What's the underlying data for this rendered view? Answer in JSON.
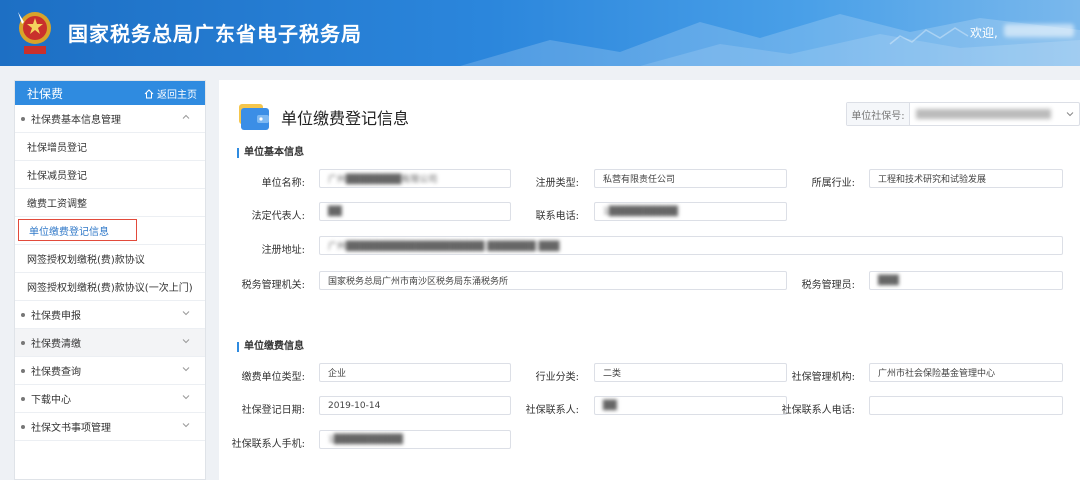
{
  "header": {
    "title": "国家税务总局广东省电子税务局",
    "welcome": "欢迎,"
  },
  "sidebar": {
    "section_title": "社保费",
    "home_label": "返回主页",
    "items": [
      {
        "label": "社保费基本信息管理"
      },
      {
        "label": "社保增员登记"
      },
      {
        "label": "社保减员登记"
      },
      {
        "label": "缴费工资调整"
      },
      {
        "label": "单位缴费登记信息"
      },
      {
        "label": "网签授权划缴税(费)款协议"
      },
      {
        "label": "网签授权划缴税(费)款协议(一次上门)"
      },
      {
        "label": "社保费申报"
      },
      {
        "label": "社保费清缴"
      },
      {
        "label": "社保费查询"
      },
      {
        "label": "下载中心"
      },
      {
        "label": "社保文书事项管理"
      }
    ]
  },
  "main": {
    "title": "单位缴费登记信息",
    "ssn_label": "单位社保号:",
    "ssn_value": "████████ 广州████████",
    "basic": {
      "section": "单位基本信息",
      "name_label": "单位名称:",
      "name_value": "广州████████有限公司",
      "reg_type_label": "注册类型:",
      "reg_type_value": "私营有限责任公司",
      "industry_label": "所属行业:",
      "industry_value": "工程和技术研究和试验发展",
      "legal_label": "法定代表人:",
      "legal_value": "██",
      "phone_label": "联系电话:",
      "phone_value": "1██████████",
      "address_label": "注册地址:",
      "address_value": "广州████████████████████ ███████ ███",
      "tax_org_label": "税务管理机关:",
      "tax_org_value": "国家税务总局广州市南沙区税务局东涌税务所",
      "tax_admin_label": "税务管理员:",
      "tax_admin_value": "███"
    },
    "payment": {
      "section": "单位缴费信息",
      "unit_type_label": "缴费单位类型:",
      "unit_type_value": "企业",
      "industry_class_label": "行业分类:",
      "industry_class_value": "二类",
      "agency_label": "社保管理机构:",
      "agency_value": "广州市社会保险基金管理中心",
      "reg_date_label": "社保登记日期:",
      "reg_date_value": "2019-10-14",
      "contact_label": "社保联系人:",
      "contact_value": "██",
      "contact_phone_label": "社保联系人电话:",
      "contact_phone_value": "",
      "mobile_label": "社保联系人手机:",
      "mobile_value": "1██████████"
    }
  }
}
